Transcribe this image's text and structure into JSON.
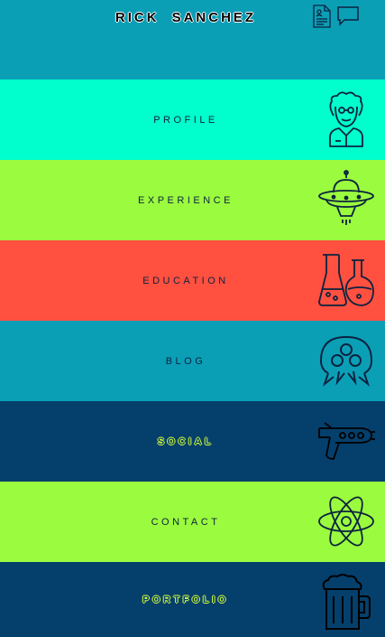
{
  "header": {
    "title_first": "RICK",
    "title_last": "SANCHEZ",
    "icons": [
      "resume-icon",
      "chat-icon"
    ]
  },
  "menu": {
    "profile": {
      "label": "PROFILE",
      "icon": "scientist-icon"
    },
    "experience": {
      "label": "EXPERIENCE",
      "icon": "ufo-icon"
    },
    "education": {
      "label": "EDUCATION",
      "icon": "flasks-icon"
    },
    "blog": {
      "label": "BLOG",
      "icon": "alien-creature-icon"
    },
    "social": {
      "label": "SOCIAL",
      "icon": "ray-gun-icon"
    },
    "contact": {
      "label": "CONTACT",
      "icon": "atom-icon"
    },
    "portfolio": {
      "label": "PORTFOLIO",
      "icon": "beer-mug-icon"
    }
  },
  "colors": {
    "header_bg": "#0b9fb6",
    "profile_bg": "#00ffcc",
    "experience_bg": "#9bfb3e",
    "education_bg": "#ff5040",
    "blog_bg": "#0b9fb6",
    "social_bg": "#053f6c",
    "contact_bg": "#9bfb3e",
    "portfolio_bg": "#053f6c",
    "label_highlight": "#d4ff3a"
  }
}
